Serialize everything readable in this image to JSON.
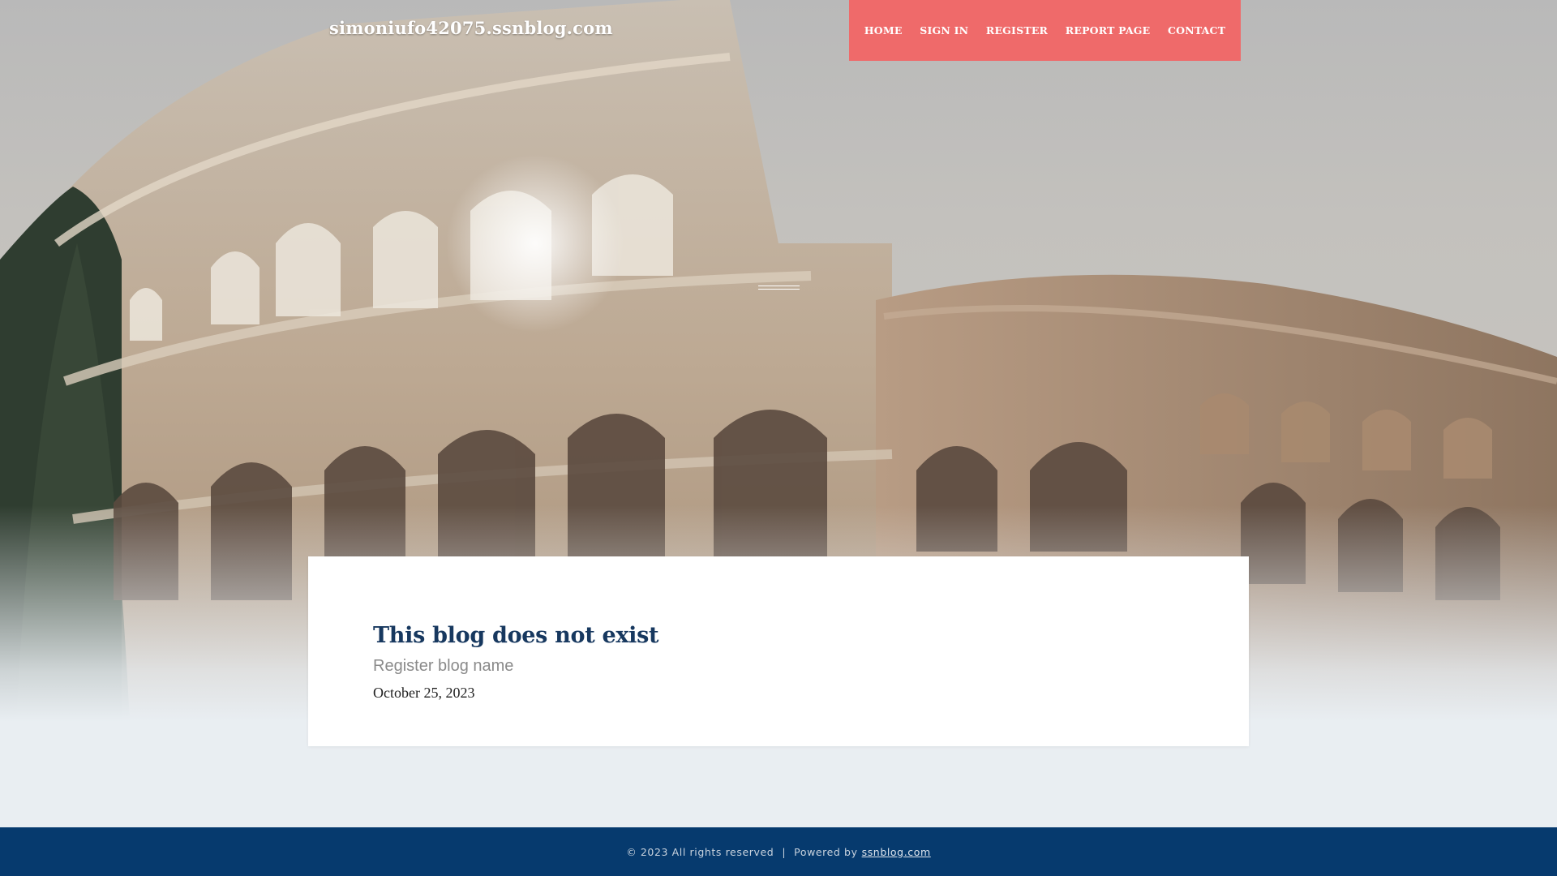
{
  "header": {
    "site_title": "simoniufo42075.ssnblog.com",
    "nav": [
      {
        "label": "HOME"
      },
      {
        "label": "SIGN IN"
      },
      {
        "label": "REGISTER"
      },
      {
        "label": "REPORT PAGE"
      },
      {
        "label": "CONTACT"
      }
    ],
    "nav_color": "#ef6a6a"
  },
  "hero": {
    "image": "colosseum-photo"
  },
  "card": {
    "title": "This blog does not exist",
    "subtitle": "Register blog name",
    "date": "October 25, 2023"
  },
  "footer": {
    "copyright": "© 2023 All rights reserved",
    "separator": "|",
    "powered_by": "Powered by",
    "powered_link": "ssnblog.com",
    "background": "#063a6e"
  },
  "colors": {
    "title": "#17385f",
    "page_bg": "#e9eef2"
  }
}
